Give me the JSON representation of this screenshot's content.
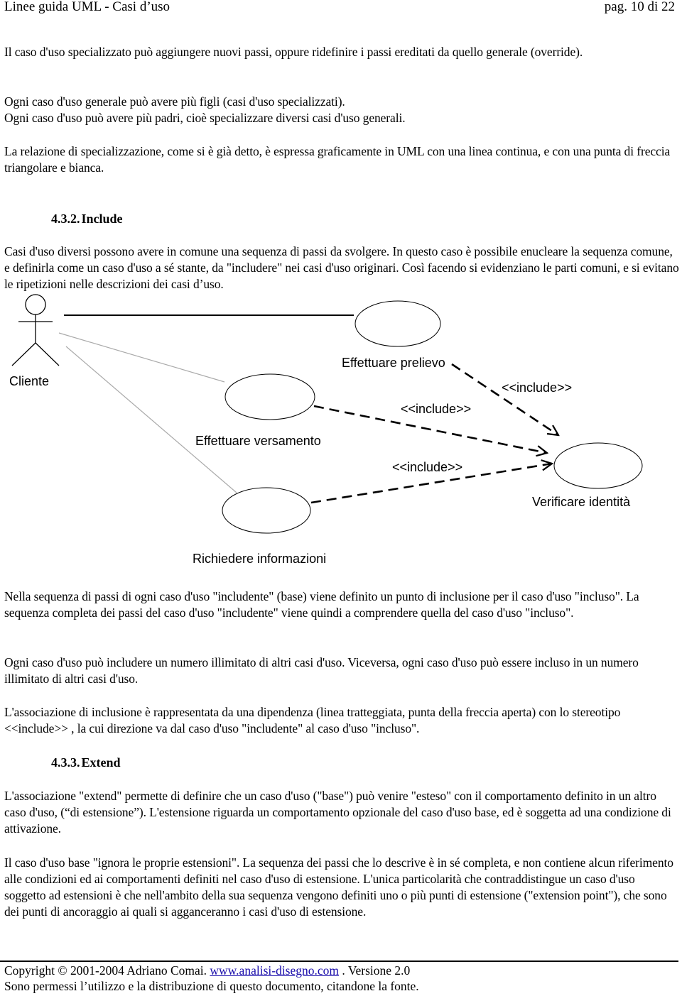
{
  "header": {
    "title": "Linee guida UML - Casi d’uso",
    "page": "pag. 10 di 22"
  },
  "paragraphs": {
    "p1": "Il caso d'uso specializzato può aggiungere nuovi passi, oppure ridefinire i passi ereditati da quello generale (override).",
    "p2a": "Ogni caso d'uso generale può avere più figli (casi d'uso specializzati).",
    "p2b": "Ogni caso d'uso può avere più padri, cioè specializzare diversi casi d'uso generali.",
    "p3": "La relazione di specializzazione, come si è già detto, è espressa graficamente in UML con una linea continua, e con una punta di freccia triangolare e bianca.",
    "p4": "Casi d'uso diversi possono avere in comune una sequenza di passi da svolgere. In questo caso è possibile enucleare la sequenza comune, e definirla come un caso d'uso a sé stante, da \"includere\" nei casi d'uso originari. Così facendo si evidenziano le parti comuni, e si evitano le ripetizioni nelle descrizioni dei casi d’uso.",
    "p5": "Nella sequenza di passi di ogni caso d'uso \"includente\" (base) viene definito un punto di inclusione per il caso d'uso \"incluso\". La sequenza completa dei passi del caso d'uso \"includente\" viene quindi a comprendere quella del caso d'uso \"incluso\".",
    "p6": "Ogni caso d'uso può includere un numero illimitato di altri casi d'uso. Viceversa, ogni caso d'uso può essere incluso in un numero illimitato di altri casi d'uso.",
    "p7": "L'associazione di inclusione è rappresentata da una dipendenza (linea tratteggiata, punta della freccia aperta) con lo stereotipo <<include>> , la cui direzione va dal caso d'uso \"includente\" al caso d'uso \"incluso\".",
    "p8": "L'associazione \"extend\" permette di definire che un caso d'uso (\"base\") può venire \"esteso\" con il comportamento definito in un altro caso d'uso, (“di estensione”). L'estensione riguarda un comportamento opzionale del caso d'uso base, ed è soggetta ad una condizione di attivazione.",
    "p9": "Il caso d'uso base \"ignora le proprie estensioni\". La sequenza dei passi che lo descrive è in sé completa, e non contiene alcun riferimento alle condizioni ed ai comportamenti definiti nel caso d'uso di estensione. L'unica particolarità che contraddistingue un caso d'uso soggetto ad estensioni è che nell'ambito della sua sequenza vengono definiti uno o più punti di estensione (\"extension point\"), che sono dei punti di ancoraggio ai quali si agganceranno i casi d'uso di estensione."
  },
  "headings": {
    "include": {
      "number": "4.3.2.",
      "title": "Include"
    },
    "extend": {
      "number": "4.3.3.",
      "title": "Extend"
    }
  },
  "diagram": {
    "actor": {
      "label": "Cliente",
      "icon": "stick-figure-actor-icon"
    },
    "use_cases": {
      "prelievo": "Effettuare prelievo",
      "versamento": "Effettuare versamento",
      "informazioni": "Richiedere informazioni",
      "identita": "Verificare identità"
    },
    "include_labels": {
      "prelievo_to_identita": "<<include>>",
      "versamento_to_identita": "<<include>>",
      "informazioni_to_identita": "<<include>>"
    }
  },
  "footer": {
    "copyright": "Copyright © 2001-2004 Adriano Comai.",
    "link": "www.analisi-disegno.com",
    "version": ". Versione 2.0",
    "notice": "Sono permessi l’utilizzo e la distribuzione di questo documento, citandone la fonte."
  }
}
